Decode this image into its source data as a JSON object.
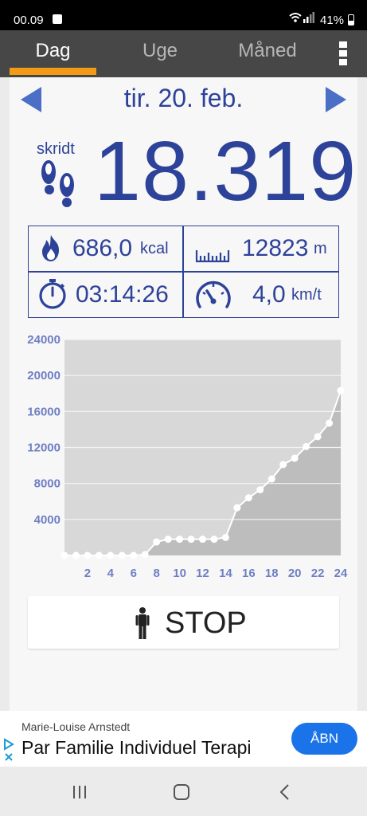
{
  "status_bar": {
    "time": "00.09",
    "battery": "41%",
    "wifi_icon": "wifi-icon",
    "signal_icon": "signal-icon"
  },
  "tabs": [
    {
      "label": "Dag",
      "active": true
    },
    {
      "label": "Uge",
      "active": false
    },
    {
      "label": "Måned",
      "active": false
    }
  ],
  "date": "tir. 20. feb.",
  "steps": {
    "label": "skridt",
    "value": "18.319"
  },
  "stats": {
    "calories": {
      "value": "686,0",
      "unit": "kcal",
      "icon": "flame-icon"
    },
    "distance": {
      "value": "12823",
      "unit": "m",
      "icon": "ruler-icon"
    },
    "time": {
      "value": "03:14:26",
      "icon": "stopwatch-icon"
    },
    "speed": {
      "value": "4,0",
      "unit": "km/t",
      "icon": "speedometer-icon"
    }
  },
  "colors": {
    "accent": "#2d4299",
    "tab_indicator": "#f39a16",
    "arrow": "#4b6ec7",
    "chart_axis_label": "#6f7fc4"
  },
  "chart_data": {
    "type": "area",
    "x": [
      0,
      1,
      2,
      3,
      4,
      5,
      6,
      7,
      8,
      9,
      10,
      11,
      12,
      13,
      14,
      15,
      16,
      17,
      18,
      19,
      20,
      21,
      22,
      23,
      24
    ],
    "values": [
      0,
      0,
      0,
      0,
      0,
      0,
      0,
      100,
      1500,
      1800,
      1800,
      1800,
      1800,
      1800,
      2000,
      5300,
      6400,
      7300,
      8500,
      10100,
      10800,
      12100,
      13200,
      14700,
      18319
    ],
    "y_ticks": [
      "24000",
      "20000",
      "16000",
      "12000",
      "8000",
      "4000"
    ],
    "x_ticks": [
      "2",
      "4",
      "6",
      "8",
      "10",
      "12",
      "14",
      "16",
      "18",
      "20",
      "22",
      "24"
    ],
    "ylim": [
      0,
      24000
    ],
    "xlim": [
      0,
      24
    ],
    "grid": true
  },
  "stop_button": {
    "label": "STOP",
    "icon": "person-icon"
  },
  "ad": {
    "advertiser": "Marie-Louise Arnstedt",
    "headline": "Par Familie Individuel Terapi",
    "button": "ÅBN"
  }
}
